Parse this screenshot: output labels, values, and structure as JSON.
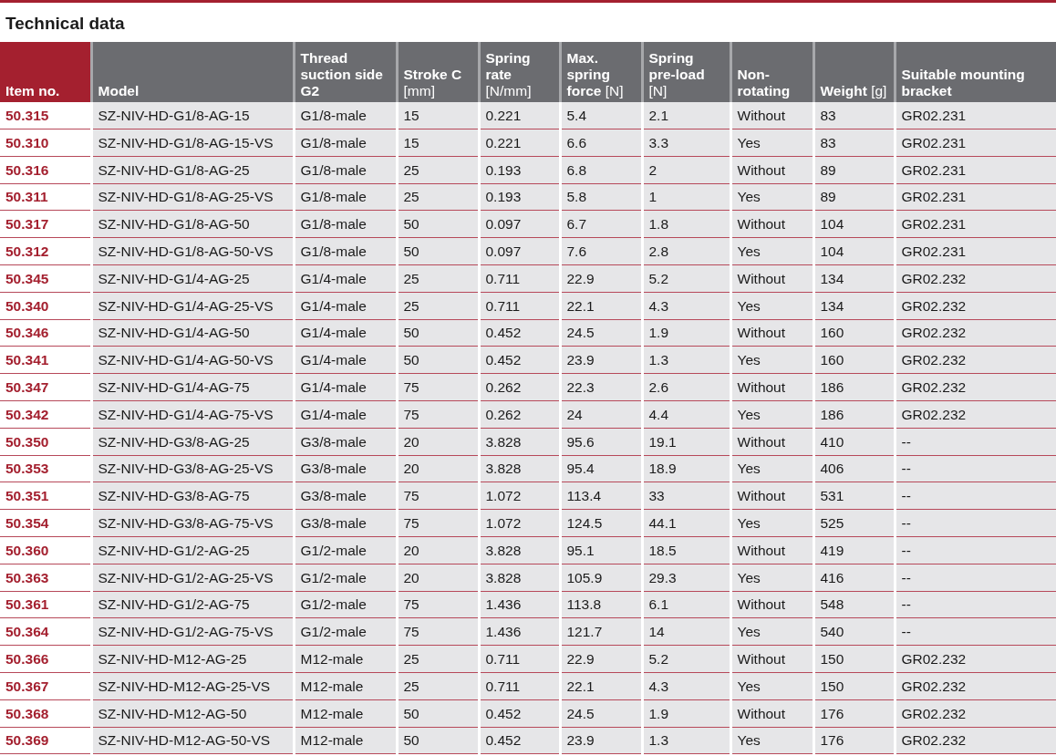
{
  "title": "Technical data",
  "table": {
    "columns": [
      "**Item no.**",
      "**Model**",
      "**Thread suction side G2**",
      "**Stroke C** [mm]",
      "**Spring rate** [N/mm]",
      "**Max. spring force** [N]",
      "**Spring pre-load** [N]",
      "**Non-rotating**",
      "**Weight** [g]",
      "**Suitable mounting bracket**"
    ],
    "rows": [
      [
        "50.315",
        "SZ-NIV-HD-G1/8-AG-15",
        "G1/8-male",
        "15",
        "0.221",
        "5.4",
        "2.1",
        "Without",
        "83",
        "GR02.231"
      ],
      [
        "50.310",
        "SZ-NIV-HD-G1/8-AG-15-VS",
        "G1/8-male",
        "15",
        "0.221",
        "6.6",
        "3.3",
        "Yes",
        "83",
        "GR02.231"
      ],
      [
        "50.316",
        "SZ-NIV-HD-G1/8-AG-25",
        "G1/8-male",
        "25",
        "0.193",
        "6.8",
        "2",
        "Without",
        "89",
        "GR02.231"
      ],
      [
        "50.311",
        "SZ-NIV-HD-G1/8-AG-25-VS",
        "G1/8-male",
        "25",
        "0.193",
        "5.8",
        "1",
        "Yes",
        "89",
        "GR02.231"
      ],
      [
        "50.317",
        "SZ-NIV-HD-G1/8-AG-50",
        "G1/8-male",
        "50",
        "0.097",
        "6.7",
        "1.8",
        "Without",
        "104",
        "GR02.231"
      ],
      [
        "50.312",
        "SZ-NIV-HD-G1/8-AG-50-VS",
        "G1/8-male",
        "50",
        "0.097",
        "7.6",
        "2.8",
        "Yes",
        "104",
        "GR02.231"
      ],
      [
        "50.345",
        "SZ-NIV-HD-G1/4-AG-25",
        "G1/4-male",
        "25",
        "0.711",
        "22.9",
        "5.2",
        "Without",
        "134",
        "GR02.232"
      ],
      [
        "50.340",
        "SZ-NIV-HD-G1/4-AG-25-VS",
        "G1/4-male",
        "25",
        "0.711",
        "22.1",
        "4.3",
        "Yes",
        "134",
        "GR02.232"
      ],
      [
        "50.346",
        "SZ-NIV-HD-G1/4-AG-50",
        "G1/4-male",
        "50",
        "0.452",
        "24.5",
        "1.9",
        "Without",
        "160",
        "GR02.232"
      ],
      [
        "50.341",
        "SZ-NIV-HD-G1/4-AG-50-VS",
        "G1/4-male",
        "50",
        "0.452",
        "23.9",
        "1.3",
        "Yes",
        "160",
        "GR02.232"
      ],
      [
        "50.347",
        "SZ-NIV-HD-G1/4-AG-75",
        "G1/4-male",
        "75",
        "0.262",
        "22.3",
        "2.6",
        "Without",
        "186",
        "GR02.232"
      ],
      [
        "50.342",
        "SZ-NIV-HD-G1/4-AG-75-VS",
        "G1/4-male",
        "75",
        "0.262",
        "24",
        "4.4",
        "Yes",
        "186",
        "GR02.232"
      ],
      [
        "50.350",
        "SZ-NIV-HD-G3/8-AG-25",
        "G3/8-male",
        "20",
        "3.828",
        "95.6",
        "19.1",
        "Without",
        "410",
        "--"
      ],
      [
        "50.353",
        "SZ-NIV-HD-G3/8-AG-25-VS",
        "G3/8-male",
        "20",
        "3.828",
        "95.4",
        "18.9",
        "Yes",
        "406",
        "--"
      ],
      [
        "50.351",
        "SZ-NIV-HD-G3/8-AG-75",
        "G3/8-male",
        "75",
        "1.072",
        "113.4",
        "33",
        "Without",
        "531",
        "--"
      ],
      [
        "50.354",
        "SZ-NIV-HD-G3/8-AG-75-VS",
        "G3/8-male",
        "75",
        "1.072",
        "124.5",
        "44.1",
        "Yes",
        "525",
        "--"
      ],
      [
        "50.360",
        "SZ-NIV-HD-G1/2-AG-25",
        "G1/2-male",
        "20",
        "3.828",
        "95.1",
        "18.5",
        "Without",
        "419",
        "--"
      ],
      [
        "50.363",
        "SZ-NIV-HD-G1/2-AG-25-VS",
        "G1/2-male",
        "20",
        "3.828",
        "105.9",
        "29.3",
        "Yes",
        "416",
        "--"
      ],
      [
        "50.361",
        "SZ-NIV-HD-G1/2-AG-75",
        "G1/2-male",
        "75",
        "1.436",
        "113.8",
        "6.1",
        "Without",
        "548",
        "--"
      ],
      [
        "50.364",
        "SZ-NIV-HD-G1/2-AG-75-VS",
        "G1/2-male",
        "75",
        "1.436",
        "121.7",
        "14",
        "Yes",
        "540",
        "--"
      ],
      [
        "50.366",
        "SZ-NIV-HD-M12-AG-25",
        "M12-male",
        "25",
        "0.711",
        "22.9",
        "5.2",
        "Without",
        "150",
        "GR02.232"
      ],
      [
        "50.367",
        "SZ-NIV-HD-M12-AG-25-VS",
        "M12-male",
        "25",
        "0.711",
        "22.1",
        "4.3",
        "Yes",
        "150",
        "GR02.232"
      ],
      [
        "50.368",
        "SZ-NIV-HD-M12-AG-50",
        "M12-male",
        "50",
        "0.452",
        "24.5",
        "1.9",
        "Without",
        "176",
        "GR02.232"
      ],
      [
        "50.369",
        "SZ-NIV-HD-M12-AG-50-VS",
        "M12-male",
        "50",
        "0.452",
        "23.9",
        "1.3",
        "Yes",
        "176",
        "GR02.232"
      ]
    ]
  }
}
